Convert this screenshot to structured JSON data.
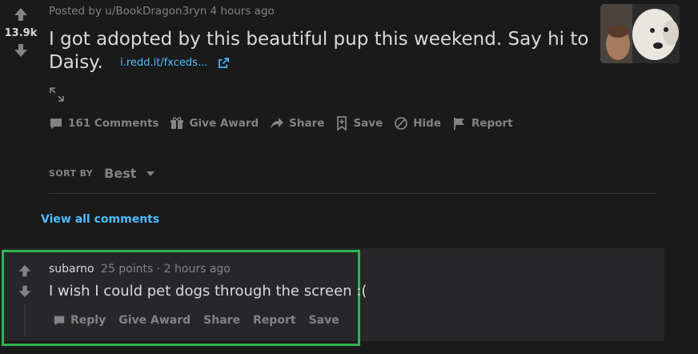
{
  "post": {
    "score": "13.9k",
    "meta": "Posted by u/BookDragon3ryn 4 hours ago",
    "title": "I got adopted by this beautiful pup this weekend. Say hi to Daisy.",
    "link": "i.redd.it/fxceds...",
    "actions": {
      "comments": "161 Comments",
      "give_award": "Give Award",
      "share": "Share",
      "save": "Save",
      "hide": "Hide",
      "report": "Report"
    }
  },
  "sort": {
    "label": "SORT BY",
    "value": "Best"
  },
  "view_all": "View all comments",
  "comment": {
    "author": "subarno",
    "info": "25 points · 2 hours ago",
    "body": "I wish I could pet dogs through the screen :(",
    "actions": {
      "reply": "Reply",
      "give_award": "Give Award",
      "share": "Share",
      "report": "Report",
      "save": "Save"
    }
  },
  "colors": {
    "background": "#1a1a1b",
    "link": "#4fbcff",
    "highlight": "#2eb64b",
    "muted": "#818384"
  }
}
